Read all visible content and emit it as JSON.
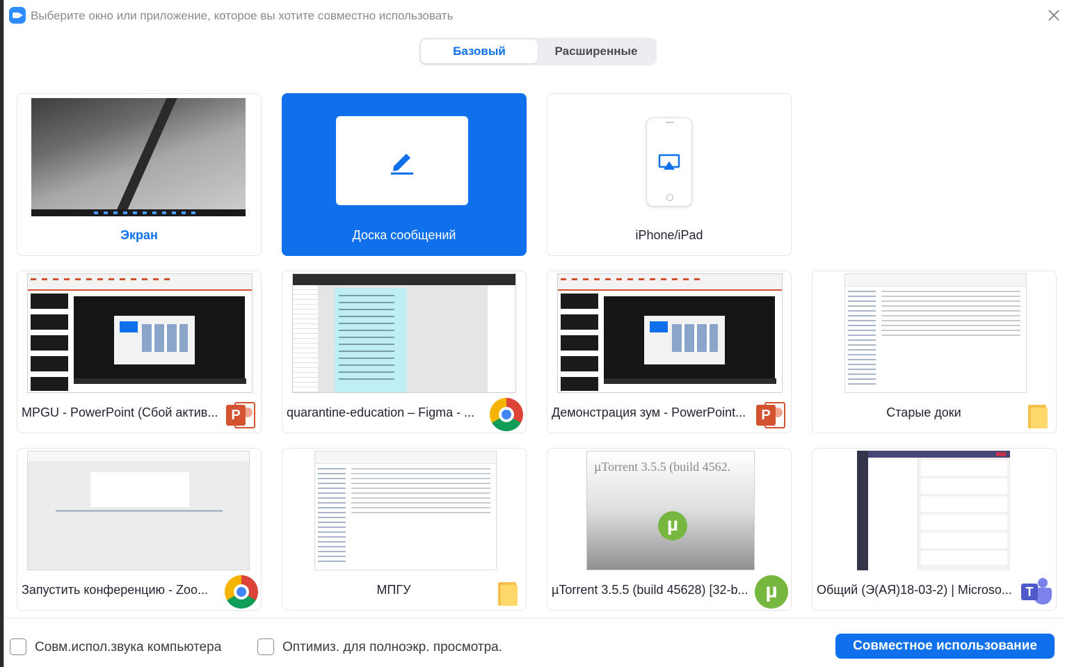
{
  "window": {
    "title": "Выберите окно или приложение, которое вы хотите совместно использовать"
  },
  "tabs": [
    {
      "label": "Базовый",
      "active": true
    },
    {
      "label": "Расширенные",
      "active": false
    }
  ],
  "sources": [
    {
      "label": "Экран",
      "kind": "screen",
      "selected": false
    },
    {
      "label": "Доска сообщений",
      "kind": "whiteboard",
      "icon": "pencil-icon",
      "selected": true
    },
    {
      "label": "iPhone/iPad",
      "kind": "device",
      "icon": "airplay-icon",
      "selected": false
    },
    {
      "label": "MPGU - PowerPoint (Сбой актив...",
      "app_icon": "powerpoint-icon"
    },
    {
      "label": "quarantine-education – Figma - ...",
      "app_icon": "chrome-icon"
    },
    {
      "label": "Демонстрация зум - PowerPoint...",
      "app_icon": "powerpoint-icon"
    },
    {
      "label": "Старые доки",
      "app_icon": "folder-icon"
    },
    {
      "label": "Запустить конференцию - Zoo...",
      "app_icon": "chrome-icon"
    },
    {
      "label": "МПГУ",
      "app_icon": "folder-icon"
    },
    {
      "label": "µTorrent 3.5.5  (build 45628) [32-b...",
      "app_icon": "utorrent-icon",
      "thumb_title": "µTorrent 3.5.5  (build 4562."
    },
    {
      "label": "Общий (Э(АЯ)18-03-2) | Microso...",
      "app_icon": "teams-icon"
    }
  ],
  "footer": {
    "share_sound_label": "Совм.испол.звука компьютера",
    "share_sound_checked": false,
    "optimize_label": "Оптимиз. для полноэкр. просмотра.",
    "optimize_checked": false,
    "share_button_label": "Совместное использование"
  },
  "colors": {
    "accent": "#0e71eb",
    "powerpoint": "#d35230",
    "utorrent": "#76b83f",
    "teams": "#5059c9"
  }
}
